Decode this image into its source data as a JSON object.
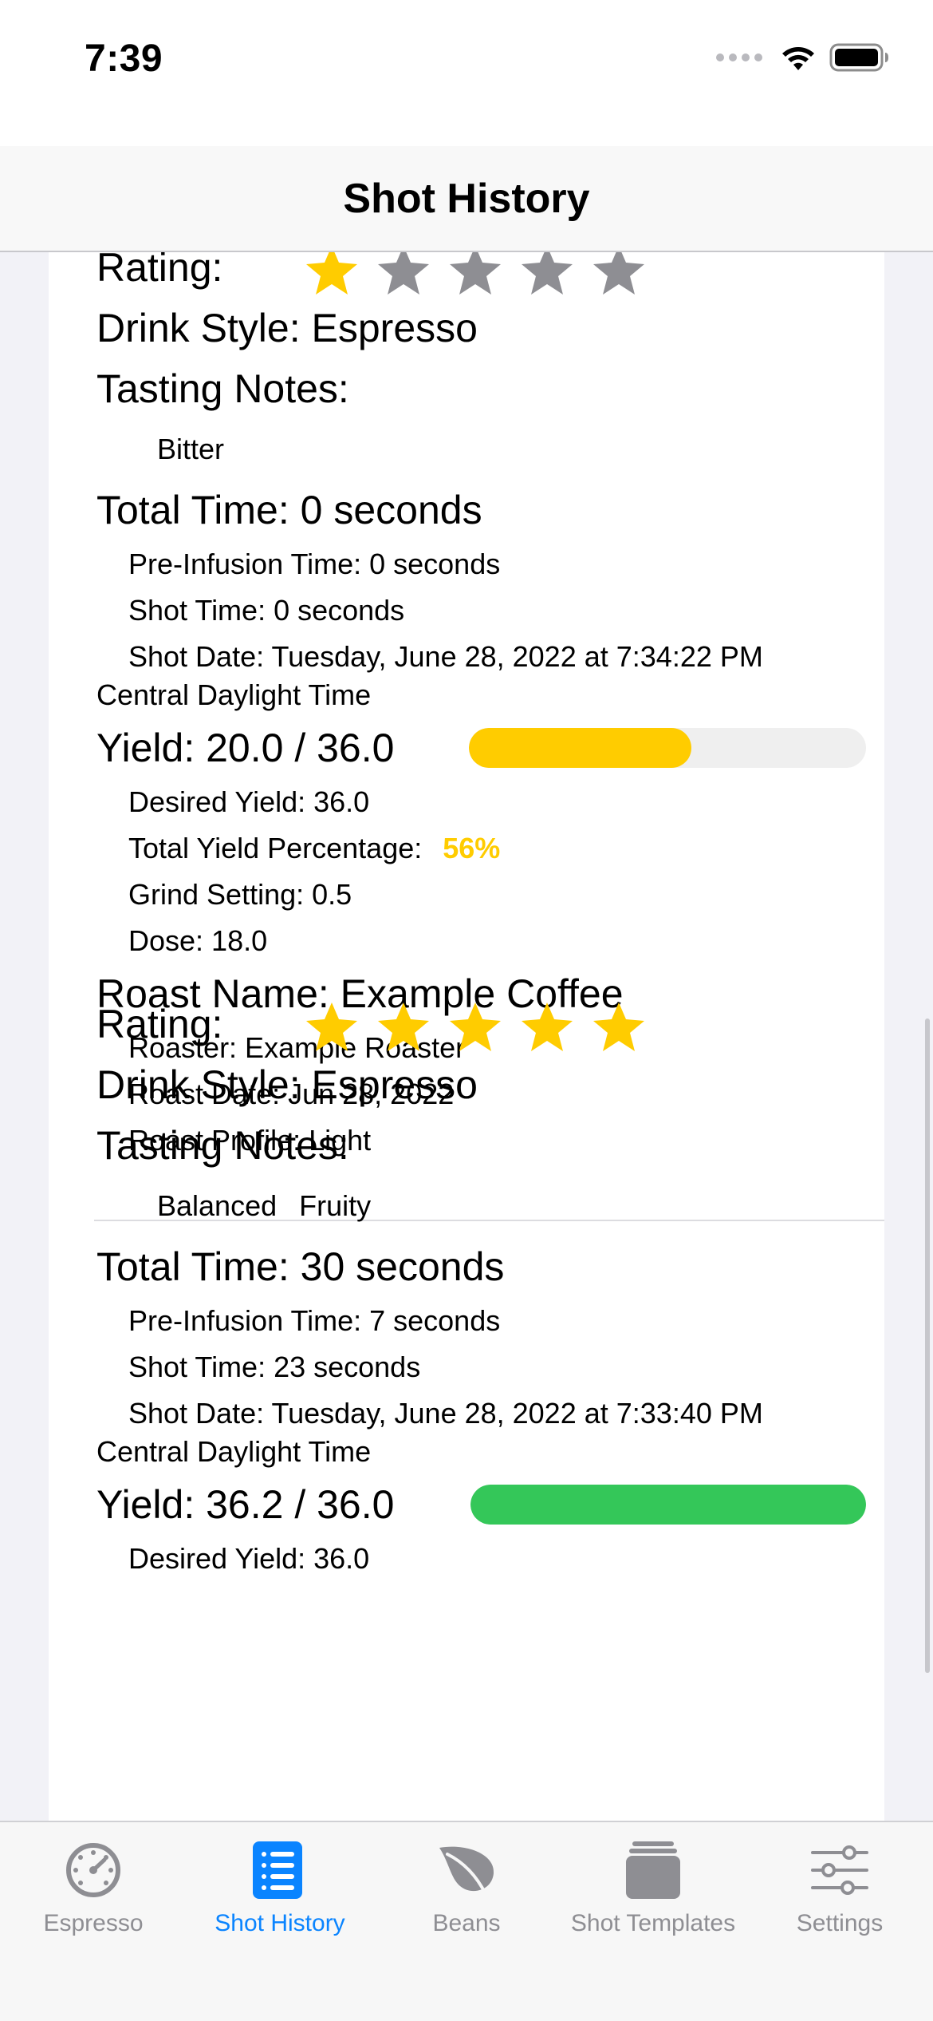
{
  "status_bar": {
    "time": "7:39"
  },
  "nav": {
    "title": "Shot History"
  },
  "shots": [
    {
      "rating_label": "Rating:",
      "rating": 1,
      "drink_style": "Drink Style: Espresso",
      "tasting_notes_label": "Tasting Notes:",
      "tasting_notes": [
        "Bitter"
      ],
      "total_time": "Total Time: 0 seconds",
      "pre_infusion": "Pre-Infusion Time: 0 seconds",
      "shot_time": "Shot Time: 0 seconds",
      "shot_date": "Shot Date: Tuesday, June 28, 2022 at 7:34:22 PM",
      "shot_date_tz": "Central Daylight Time",
      "yield": "Yield: 20.0 / 36.0",
      "yield_fraction": 0.56,
      "yield_color": "#ffcc00",
      "desired_yield": "Desired Yield: 36.0",
      "total_yield_label": "Total Yield Percentage:",
      "total_yield_pct": "56%",
      "grind_setting": "Grind Setting: 0.5",
      "dose": "Dose: 18.0",
      "roast_name": "Roast Name: Example Coffee",
      "roaster": "Roaster: Example Roaster",
      "roast_date": "Roast Date: Jun 28, 2022",
      "roast_profile": "Roast Profile: Light"
    },
    {
      "rating_label": "Rating:",
      "rating": 5,
      "drink_style": "Drink Style: Espresso",
      "tasting_notes_label": "Tasting Notes:",
      "tasting_notes": [
        "Balanced",
        "Fruity"
      ],
      "total_time": "Total Time: 30 seconds",
      "pre_infusion": "Pre-Infusion Time: 7 seconds",
      "shot_time": "Shot Time: 23 seconds",
      "shot_date": "Shot Date: Tuesday, June 28, 2022 at 7:33:40 PM",
      "shot_date_tz": "Central Daylight Time",
      "yield": "Yield: 36.2 / 36.0",
      "yield_fraction": 1.0,
      "yield_color": "#34c759",
      "desired_yield": "Desired Yield: 36.0"
    }
  ],
  "colors": {
    "star_on": "#ffcc00",
    "star_off": "#8e8e93",
    "accent": "#0a84ff"
  },
  "tabs": [
    {
      "label": "Espresso",
      "icon": "gauge-icon",
      "active": false
    },
    {
      "label": "Shot History",
      "icon": "list-icon",
      "active": true
    },
    {
      "label": "Beans",
      "icon": "leaf-icon",
      "active": false
    },
    {
      "label": "Shot Templates",
      "icon": "archive-box-icon",
      "active": false
    },
    {
      "label": "Settings",
      "icon": "sliders-icon",
      "active": false
    }
  ]
}
